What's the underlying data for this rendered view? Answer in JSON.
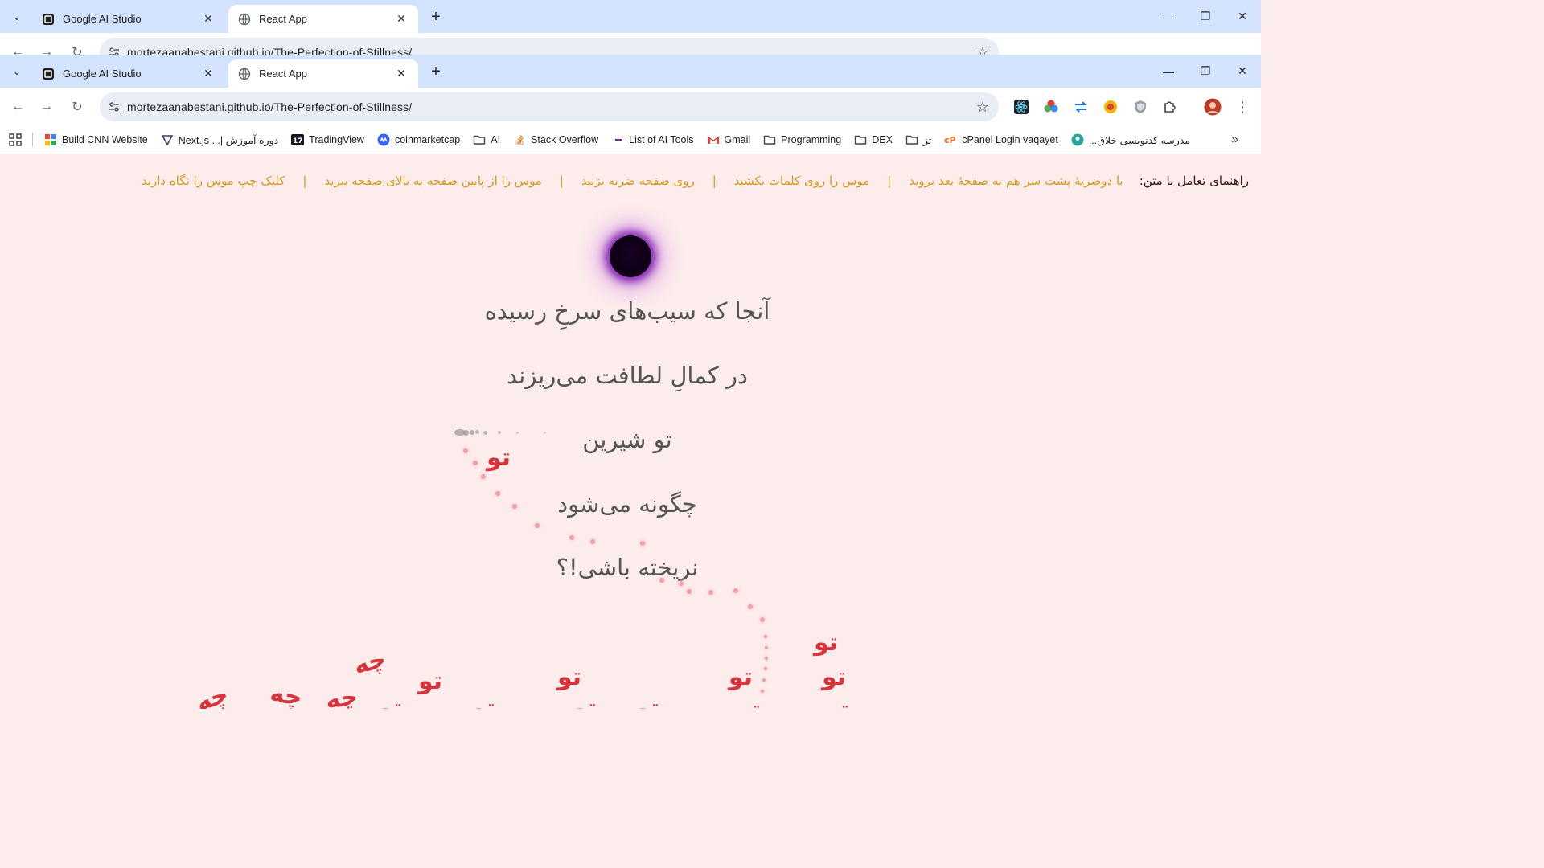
{
  "browser": {
    "tabs": [
      {
        "title": "Google AI Studio",
        "active": false
      },
      {
        "title": "React App",
        "active": true
      }
    ],
    "url": "mortezaanabestani.github.io/The-Perfection-of-Stillness/",
    "bookmarks": [
      {
        "label": "Build CNN Website",
        "icon": "app-icon"
      },
      {
        "label": "دوره آموزش |... Next.js",
        "icon": "nextjs-icon"
      },
      {
        "label": "TradingView",
        "icon": "tradingview-icon"
      },
      {
        "label": "coinmarketcap",
        "icon": "coinmarketcap-icon"
      },
      {
        "label": "AI",
        "icon": "folder-icon"
      },
      {
        "label": "Stack Overflow",
        "icon": "stackoverflow-icon"
      },
      {
        "label": "List of AI Tools",
        "icon": "list-icon"
      },
      {
        "label": "Gmail",
        "icon": "gmail-icon"
      },
      {
        "label": "Programming",
        "icon": "folder-icon"
      },
      {
        "label": "DEX",
        "icon": "folder-icon"
      },
      {
        "label": "تز",
        "icon": "folder-icon"
      },
      {
        "label": "cPanel Login vaqayet",
        "icon": "cpanel-icon"
      },
      {
        "label": "مدرسه کدنویسی خلاق...",
        "icon": "school-icon"
      }
    ]
  },
  "guide": {
    "title": "راهنمای تعامل با متن:",
    "items": [
      "با دوضربهٔ پشت سر هم به صفحهٔ بعد بروید",
      "موس را روی کلمات بکشید",
      "روی صفحه ضربه بزنید",
      "موس را از پایین صفحه به بالای صفحه ببرید",
      "کلیک چپ موس را نگاه دارید"
    ],
    "separator": "|"
  },
  "poem": {
    "line1": "آنجا که سیب‌های سرخِ رسیده",
    "line2": "در کمالِ لطافت می‌ریزند",
    "line3": "تو شیرین",
    "line4": "چگونه می‌شود",
    "line5": "نریخته باشی!؟"
  },
  "falling_words": {
    "word": "تو",
    "alt_word": "چه"
  },
  "colors": {
    "page_background": "#fdecec",
    "guide_accent": "#d79a1e",
    "falling_word": "#d8323a",
    "orb_glow": "#7814aa"
  }
}
